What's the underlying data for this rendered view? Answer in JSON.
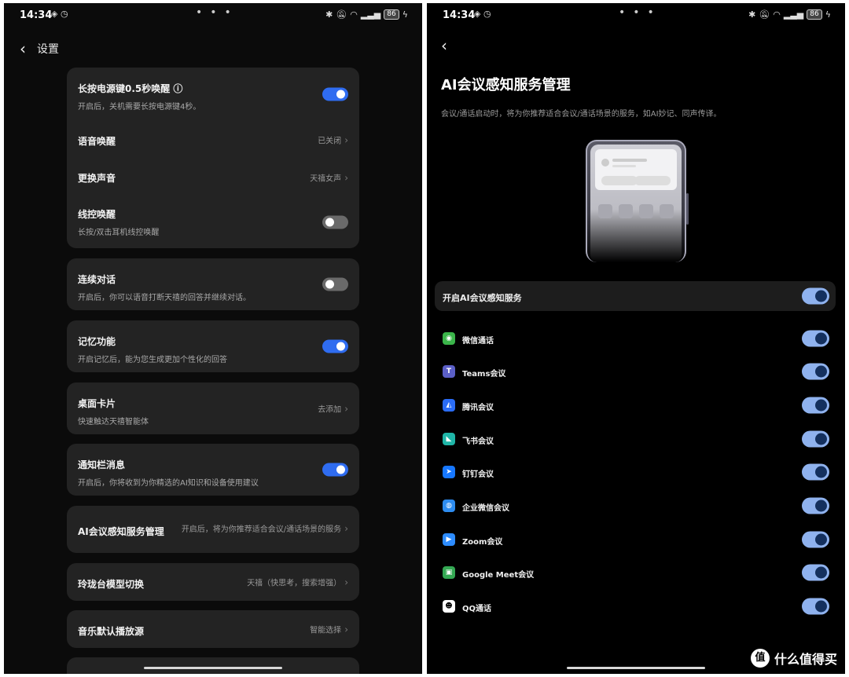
{
  "left": {
    "status": {
      "time": "14:34",
      "battery": "86"
    },
    "header": {
      "back_icon": "chevron-left-icon",
      "title": "设置"
    },
    "cards": [
      {
        "rows": [
          {
            "title": "长按电源键0.5秒唤醒 ⓘ",
            "subtitle": "开启后，关机需要长按电源键4秒。",
            "toggle": "on"
          },
          {
            "title": "语音唤醒",
            "value": "已关闭"
          },
          {
            "title": "更换声音",
            "value": "天禧女声"
          },
          {
            "title": "线控唤醒",
            "subtitle": "长按/双击耳机线控唤醒",
            "toggle": "off"
          }
        ]
      },
      {
        "rows": [
          {
            "title": "连续对话",
            "subtitle": "开启后，你可以语音打断天禧的回答并继续对话。",
            "toggle": "off"
          }
        ]
      },
      {
        "rows": [
          {
            "title": "记忆功能",
            "subtitle": "开启记忆后，能为您生成更加个性化的回答",
            "toggle": "on"
          }
        ]
      },
      {
        "rows": [
          {
            "title": "桌面卡片",
            "subtitle": "快速触达天禧智能体",
            "value": "去添加"
          }
        ]
      },
      {
        "rows": [
          {
            "title": "通知栏消息",
            "subtitle": "开启后，你将收到为你精选的AI知识和设备使用建议",
            "toggle": "on"
          }
        ]
      },
      {
        "rows": [
          {
            "title": "AI会议感知服务管理",
            "value": "开启后，将为你推荐适合会议/通话场景的服务"
          }
        ]
      },
      {
        "rows": [
          {
            "title": "玲珑台模型切换",
            "value": "天禧（快思考，搜索增强）"
          }
        ]
      },
      {
        "rows": [
          {
            "title": "音乐默认播放源",
            "value": "智能选择"
          }
        ]
      }
    ]
  },
  "right": {
    "status": {
      "time": "14:34",
      "battery": "86"
    },
    "title": "AI会议感知服务管理",
    "description": "会议/通话启动时，将为你推荐适合会议/通话场景的服务，如AI妙记、同声传译。",
    "master_toggle": {
      "label": "开启AI会议感知服务",
      "state": "on"
    },
    "services": [
      {
        "name": "微信通话",
        "icon": "wechat-icon",
        "color": "#3bb54a",
        "state": "on"
      },
      {
        "name": "Teams会议",
        "icon": "teams-icon",
        "color": "#5b5fc7",
        "state": "on"
      },
      {
        "name": "腾讯会议",
        "icon": "tencent-meeting-icon",
        "color": "#2a6cf6",
        "state": "on"
      },
      {
        "name": "飞书会议",
        "icon": "feishu-icon",
        "color": "#1fb5a7",
        "state": "on"
      },
      {
        "name": "钉钉会议",
        "icon": "dingtalk-icon",
        "color": "#1677ff",
        "state": "on"
      },
      {
        "name": "企业微信会议",
        "icon": "wecom-icon",
        "color": "#2d8cf0",
        "state": "on"
      },
      {
        "name": "Zoom会议",
        "icon": "zoom-icon",
        "color": "#2d8cff",
        "state": "on"
      },
      {
        "name": "Google Meet会议",
        "icon": "google-meet-icon",
        "color": "#34a853",
        "state": "on"
      },
      {
        "name": "QQ通话",
        "icon": "qq-icon",
        "color": "#111111",
        "state": "on"
      }
    ]
  },
  "watermark": {
    "badge": "值",
    "text": "什么值得买"
  }
}
